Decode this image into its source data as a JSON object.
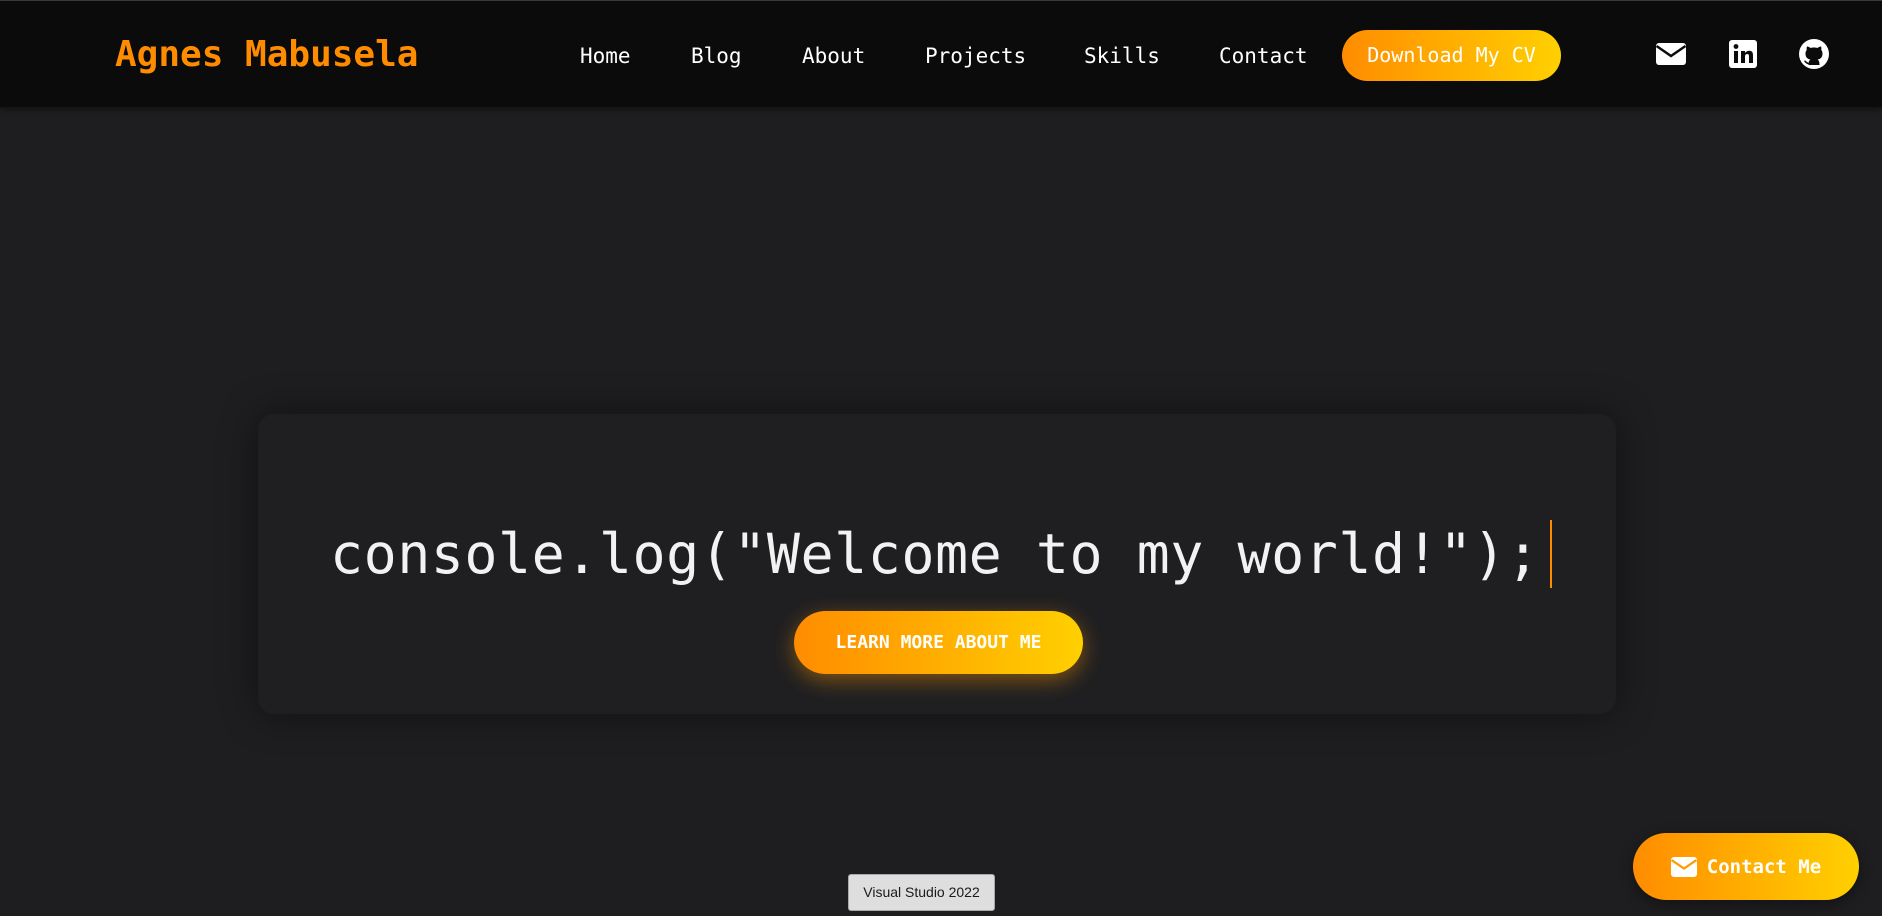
{
  "header": {
    "brand": "Agnes Mabusela",
    "nav": [
      {
        "label": "Home"
      },
      {
        "label": "Blog"
      },
      {
        "label": "About"
      },
      {
        "label": "Projects"
      },
      {
        "label": "Skills"
      },
      {
        "label": "Contact"
      }
    ],
    "cv_button": "Download My CV",
    "social_icons": [
      "envelope-icon",
      "linkedin-icon",
      "github-icon"
    ]
  },
  "hero": {
    "code_line": "console.log(\"Welcome to my world!\");",
    "cta_label": "LEARN MORE ABOUT ME"
  },
  "floating": {
    "contact_label": "Contact Me",
    "contact_icon": "envelope-icon"
  },
  "tooltip": {
    "text": "Visual Studio 2022"
  },
  "colors": {
    "accent": "#ff8c00",
    "accent_end": "#ffd000",
    "background": "#1e1e20",
    "navbar": "#0b0b0b"
  }
}
